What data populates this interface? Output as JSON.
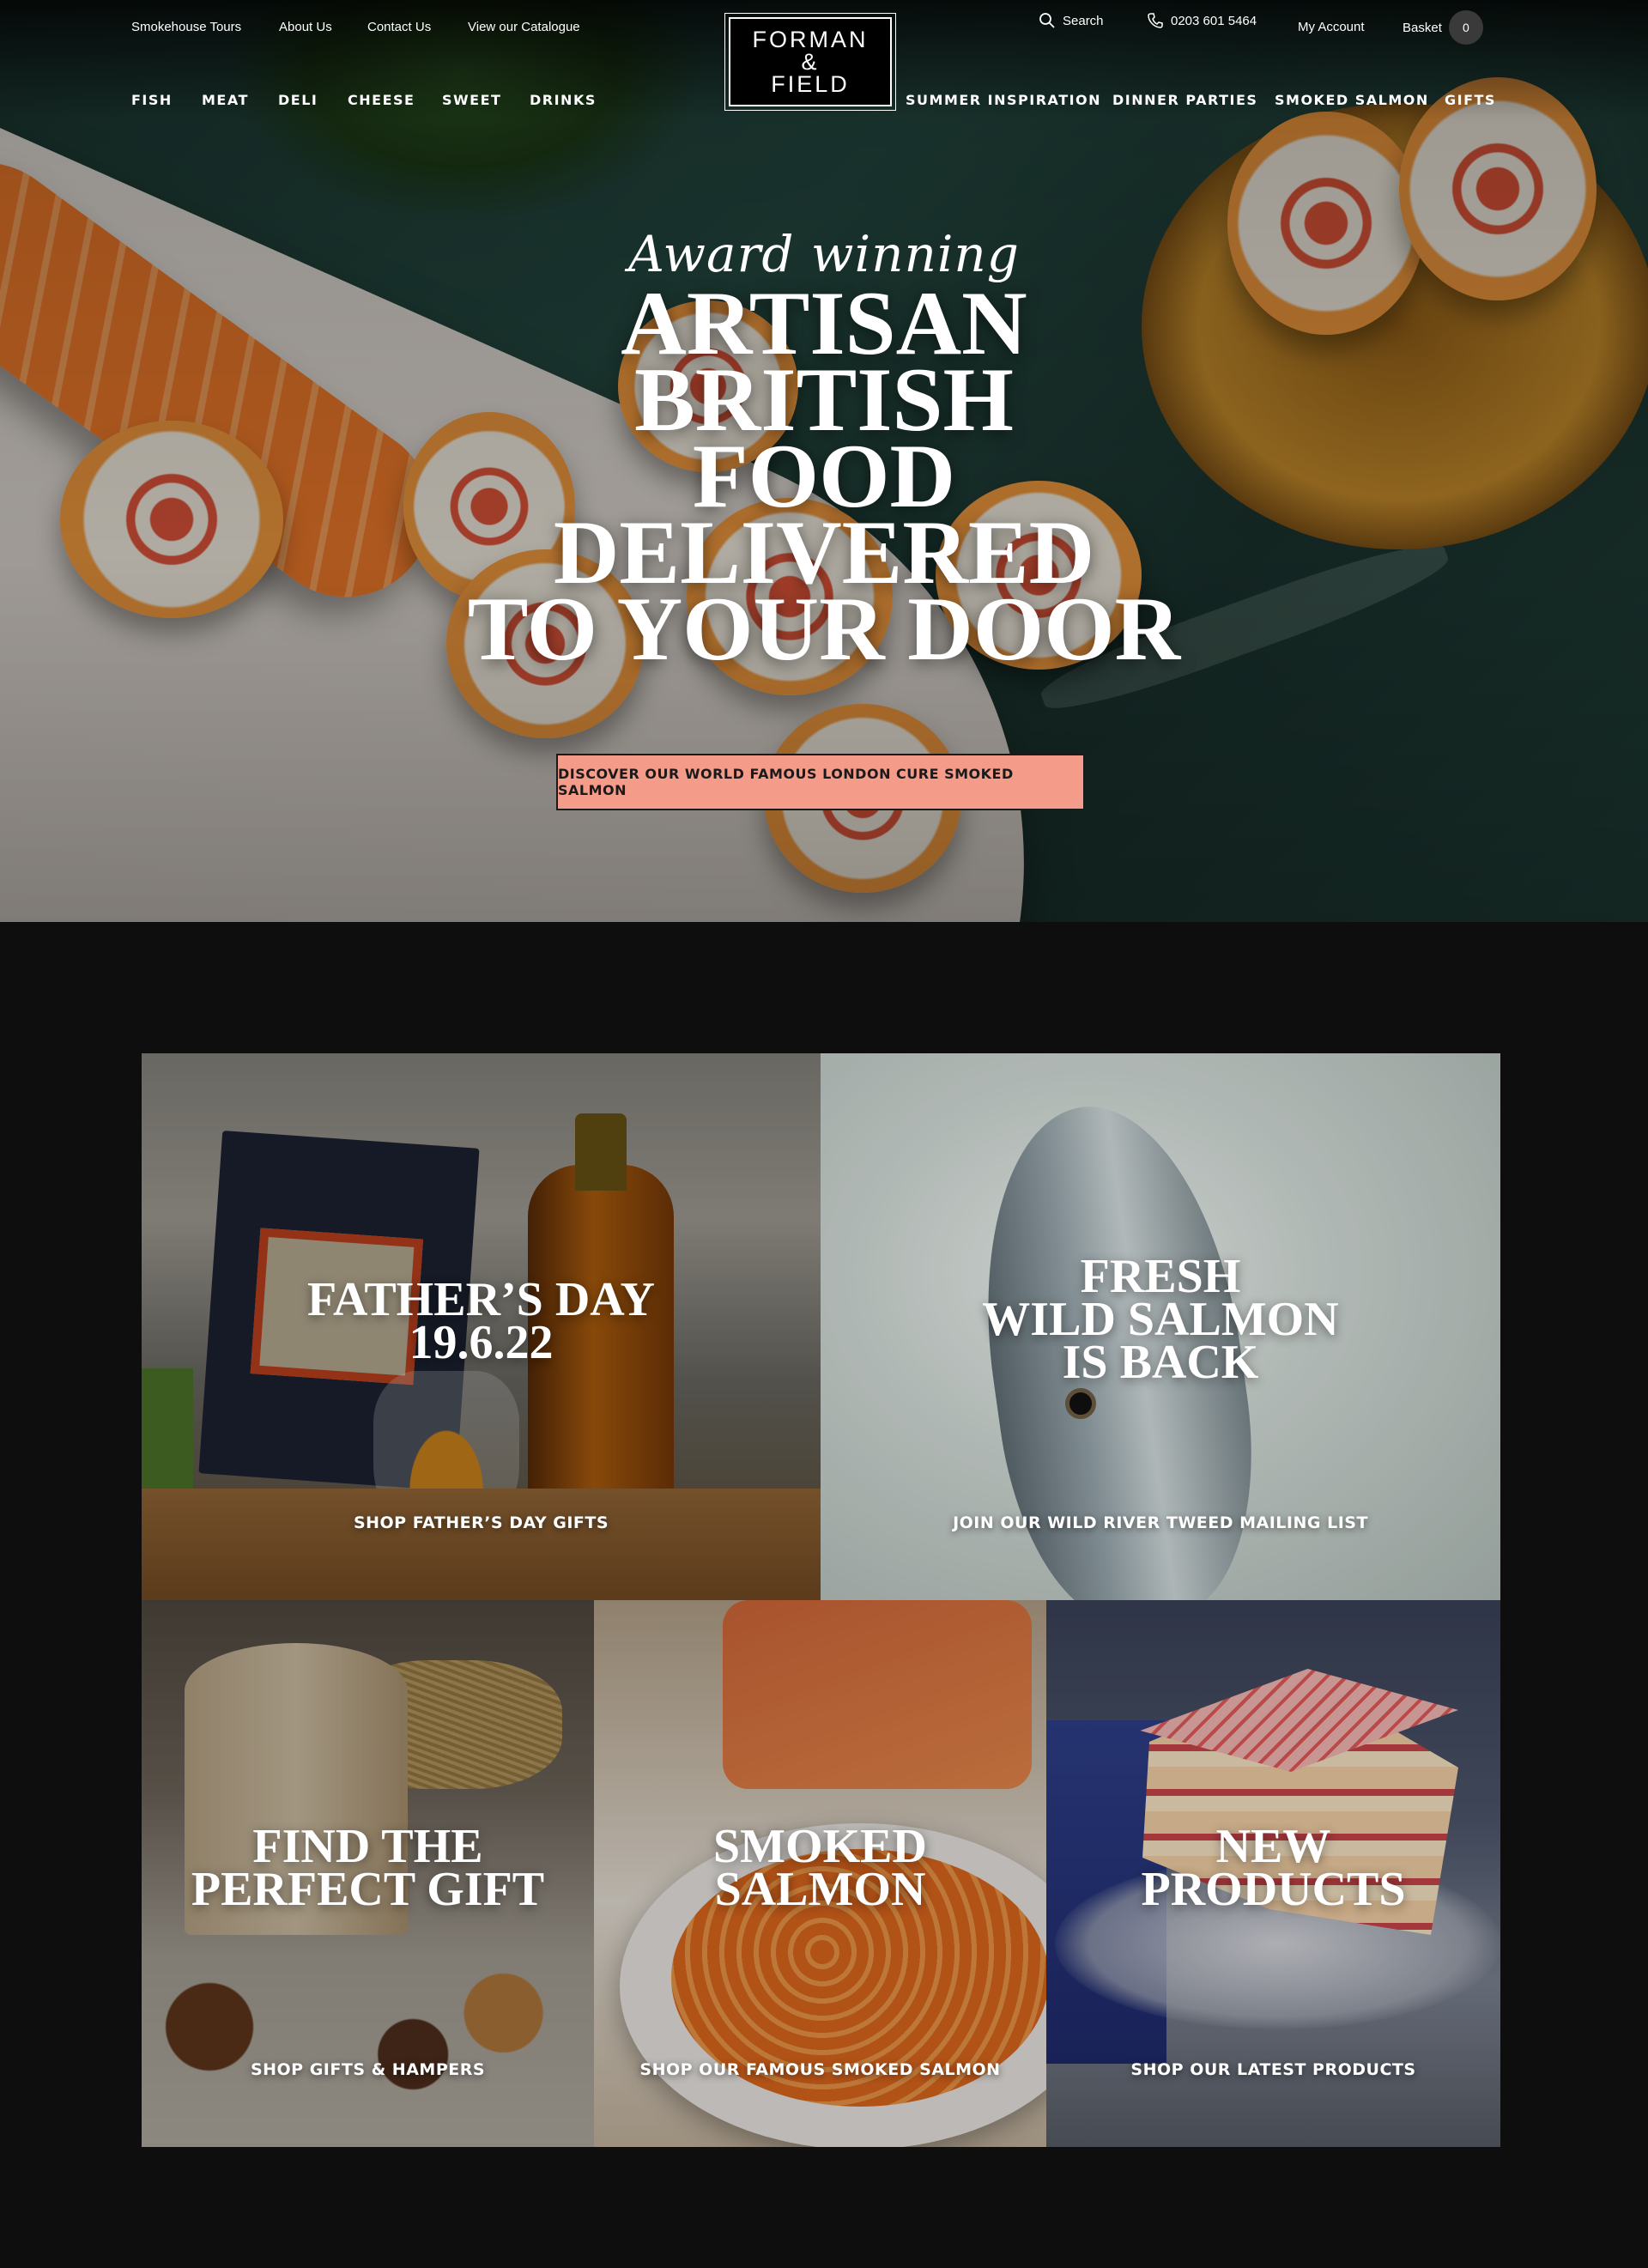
{
  "top_links": [
    "Smokehouse Tours",
    "About Us",
    "Contact Us",
    "View our Catalogue"
  ],
  "utility": {
    "search_label": "Search",
    "phone": "0203 601 5464",
    "account": "My Account",
    "basket_label": "Basket",
    "basket_count": "0"
  },
  "logo": {
    "line1": "FORMAN",
    "line2": "&",
    "line3": "FIELD"
  },
  "categories_left": [
    "FISH",
    "MEAT",
    "DELI",
    "CHEESE",
    "SWEET",
    "DRINKS"
  ],
  "categories_right": [
    "SUMMER INSPIRATION",
    "DINNER PARTIES",
    "SMOKED SALMON",
    "GIFTS"
  ],
  "hero": {
    "kicker": "Award winning",
    "headline": [
      "ARTISAN",
      "BRITISH",
      "FOOD",
      "DELIVERED",
      "TO YOUR DOOR"
    ],
    "cta": "DISCOVER OUR WORLD FAMOUS LONDON CURE SMOKED SALMON"
  },
  "tiles": {
    "fathers_day": {
      "title": [
        "FATHER’S DAY",
        "19.6.22"
      ],
      "link": "SHOP FATHER’S DAY GIFTS"
    },
    "wild_salmon": {
      "title": [
        "FRESH",
        "WILD SALMON",
        "IS BACK"
      ],
      "link": "JOIN OUR WILD RIVER TWEED MAILING LIST"
    },
    "gift": {
      "title": [
        "FIND THE",
        "PERFECT GIFT"
      ],
      "link": "SHOP GIFTS & HAMPERS"
    },
    "smoked_salmon": {
      "title": [
        "SMOKED",
        "SALMON"
      ],
      "link": "SHOP OUR FAMOUS SMOKED SALMON"
    },
    "new_products": {
      "title": [
        "NEW",
        "PRODUCTS"
      ],
      "link": "SHOP OUR LATEST PRODUCTS"
    }
  },
  "colors": {
    "page_bg": "#0e0e0e",
    "cta_bg": "#f49b8a",
    "text": "#ffffff"
  }
}
